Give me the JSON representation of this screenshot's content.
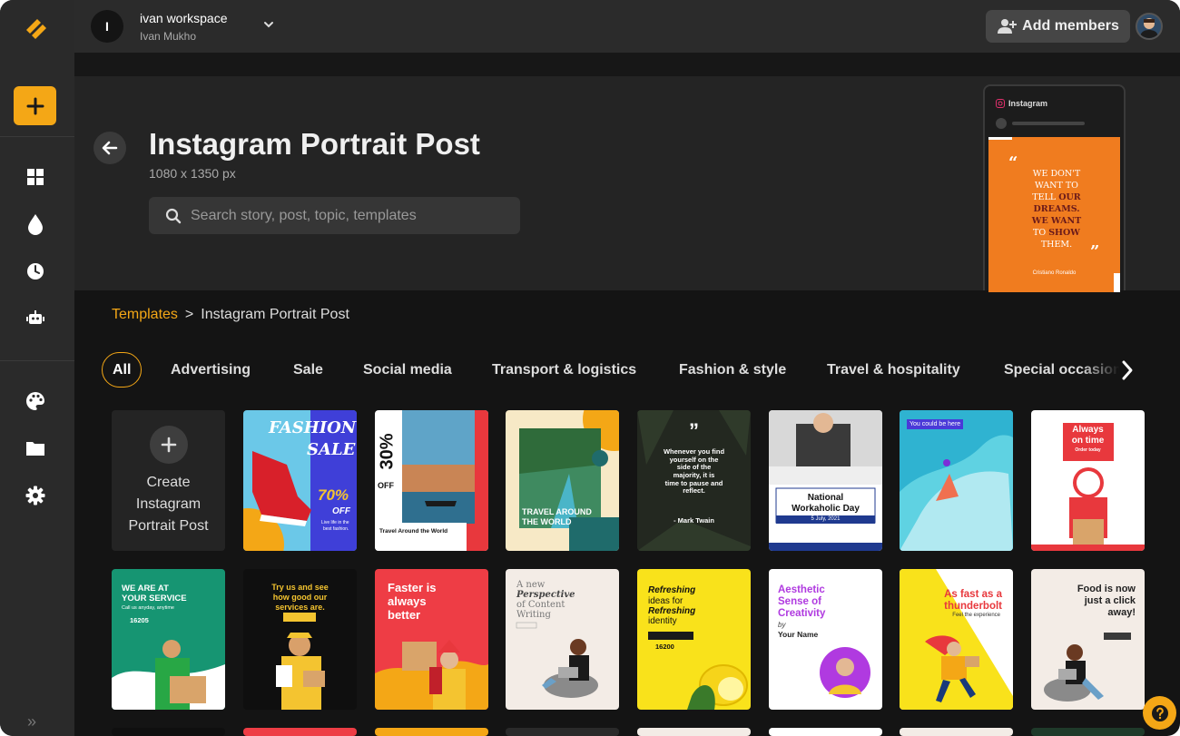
{
  "workspace": {
    "initial": "I",
    "name": "ivan workspace",
    "user": "Ivan Mukho"
  },
  "topbar": {
    "add_members_label": "Add members"
  },
  "hero": {
    "title": "Instagram Portrait Post",
    "size": "1080 x 1350 px",
    "search_placeholder": "Search story, post, topic, templates",
    "preview": {
      "platform": "Instagram",
      "quote_line1": "We don't",
      "quote_line2": "want to",
      "quote_line3a": "tell ",
      "quote_line3b": "our",
      "quote_line4": "dreams.",
      "quote_line5": "We want",
      "quote_line6a": "to ",
      "quote_line6b": "show",
      "quote_line7": "them.",
      "author": "Cristiano Ronaldo"
    }
  },
  "breadcrumb": {
    "root": "Templates",
    "separator": ">",
    "current": "Instagram Portrait Post"
  },
  "categories": [
    "All",
    "Advertising",
    "Sale",
    "Social media",
    "Transport & logistics",
    "Fashion & style",
    "Travel & hospitality",
    "Special occasions"
  ],
  "create_tile": {
    "label_line1": "Create",
    "label_line2": "Instagram",
    "label_line3": "Portrait Post"
  },
  "templates_row1": [
    {
      "line1": "FASHION",
      "line2": "SALE",
      "line3": "70%",
      "line4": "OFF",
      "line5": "Live life in the",
      "line6": "best fashion."
    },
    {
      "line1": "30%",
      "line2": "OFF",
      "line3": "Travel Around the World"
    },
    {
      "line1": "TRAVEL AROUND",
      "line2": "THE WORLD"
    },
    {
      "quote": "”",
      "line1": "Whenever you find",
      "line2": "yourself on the",
      "line3": "side of the",
      "line4": "majority, it is",
      "line5": "time to pause and",
      "line6": "reflect.",
      "author": "- Mark Twain"
    },
    {
      "line1": "National",
      "line2": "Workaholic Day",
      "line3": "5 July, 2021"
    },
    {
      "line1": "You could be here"
    },
    {
      "line1": "Always",
      "line2": "on time",
      "line3": "Order today"
    }
  ],
  "templates_row2": [
    {
      "line1": "WE ARE AT",
      "line2": "YOUR SERVICE",
      "line3": "Call us anyday, anytime",
      "line4": "16205"
    },
    {
      "line1": "Try us and see",
      "line2": "how good our",
      "line3": "services are."
    },
    {
      "line1": "Faster is",
      "line2": "always",
      "line3": "better"
    },
    {
      "line1": "A new",
      "line2": "Perspective",
      "line3": "of Content",
      "line4": "Writing"
    },
    {
      "line1": "Refreshing",
      "line2": "ideas for",
      "line3": "Refreshing",
      "line4": "identity",
      "line5": "16200"
    },
    {
      "line1": "Aesthetic",
      "line2": "Sense of",
      "line3": "Creativity",
      "line4": "by",
      "line5": "Your Name"
    },
    {
      "line1": "As fast as a",
      "line2": "thunderbolt",
      "line3": "Feel the experience"
    },
    {
      "line1": "Food is now",
      "line2": "just a click",
      "line3": "away!"
    }
  ],
  "colors": {
    "accent": "#f4a716",
    "sidebar": "#2a2a2a",
    "background": "#141414"
  }
}
